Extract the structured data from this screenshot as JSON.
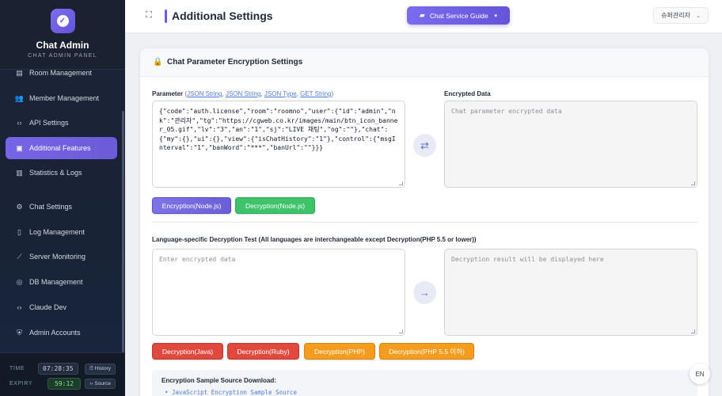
{
  "sidebar": {
    "brand_title": "Chat Admin",
    "brand_sub": "CHAT ADMIN PANEL",
    "items": [
      {
        "label": "Room Management",
        "icon": "room-icon"
      },
      {
        "label": "Member Management",
        "icon": "members-icon"
      },
      {
        "label": "API Settings",
        "icon": "code-icon"
      },
      {
        "label": "Additional Features",
        "icon": "chat-icon"
      },
      {
        "label": "Statistics & Logs",
        "icon": "chart-icon"
      },
      {
        "label": "Chat Settings",
        "icon": "gear-icon"
      },
      {
        "label": "Log Management",
        "icon": "file-icon"
      },
      {
        "label": "Server Monitoring",
        "icon": "line-chart-icon"
      },
      {
        "label": "DB Management",
        "icon": "database-icon"
      },
      {
        "label": "Claude Dev",
        "icon": "code-icon"
      },
      {
        "label": "Admin Accounts",
        "icon": "shield-icon"
      }
    ],
    "footer": {
      "time_label": "TIME",
      "time_value": "07:28:35",
      "history_label": "History",
      "expiry_label": "EXPIRY",
      "expiry_value": "59:12",
      "source_label": "Source"
    }
  },
  "header": {
    "title": "Additional Settings",
    "guide_label": "Chat Service Guide",
    "user_label": "슈퍼관리자"
  },
  "card": {
    "title": "Chat Parameter Encryption Settings",
    "param_label": "Parameter",
    "param_links": [
      "JSON String",
      "JSON String",
      "JSON Type",
      "GET String"
    ],
    "param_value": "{\"code\":\"auth.license\",\"room\":\"roomno\",\"user\":{\"id\":\"admin\",\"nk\":\"관리자\",\"tg\":\"https://cgweb.co.kr/images/main/btn_icon_banner_05.gif\",\"lv\":\"3\",\"an\":\"1\",\"sj\":\"LIVE 채팅\",\"og\":\"\"},\"chat\":{\"my\":{},\"ui\":{},\"view\":{\"isChatHistory\":\"1\"},\"control\":{\"msgInterval\":\"1\",\"banWord\":\"***\",\"banUrl\":\"\"}}}",
    "encrypted_label": "Encrypted Data",
    "encrypted_placeholder": "Chat parameter encrypted data",
    "btn_encrypt_node": "Encryption(Node.js)",
    "btn_decrypt_node": "Decryption(Node.js)",
    "lang_test_label": "Language-specific Decryption Test (All languages are interchangeable except Decryption(PHP 5.5 or lower))",
    "enc_input_placeholder": "Enter encrypted data",
    "dec_result_placeholder": "Decryption result will be displayed here",
    "btn_java": "Decryption(Java)",
    "btn_ruby": "Decryption(Ruby)",
    "btn_php": "Decryption(PHP)",
    "btn_php55": "Decryption(PHP 5.5 이하)",
    "sample_title": "Encryption Sample Source Download:",
    "sample_link": "JavaScript Encryption Sample Source"
  },
  "lang_toggle": "EN"
}
